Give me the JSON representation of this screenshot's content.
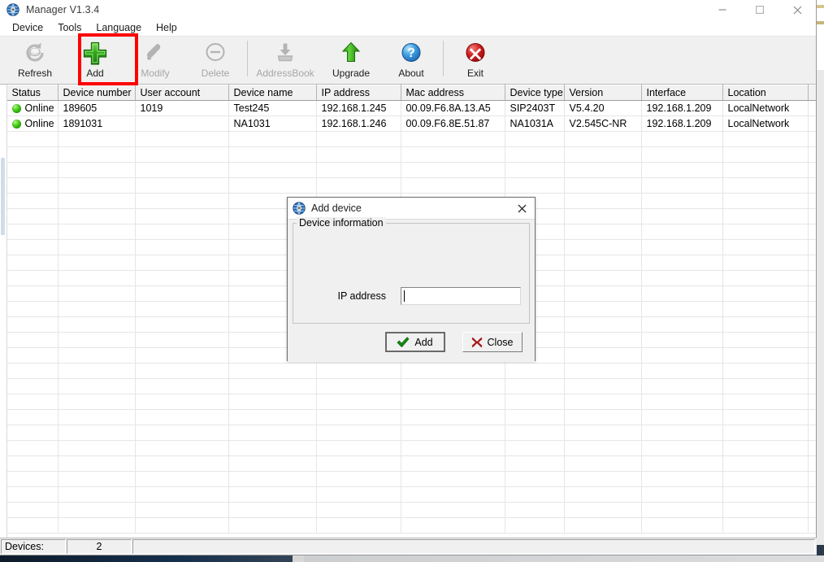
{
  "window": {
    "title": "Manager V1.3.4",
    "icon": "app-globe-icon",
    "controls": {
      "minimize": "minimize-icon",
      "maximize": "maximize-icon",
      "close": "close-icon"
    }
  },
  "menubar": {
    "items": [
      {
        "label": "Device"
      },
      {
        "label": "Tools"
      },
      {
        "label": "Language"
      },
      {
        "label": "Help"
      }
    ]
  },
  "toolbar": {
    "items": [
      {
        "label": "Refresh",
        "icon": "refresh-icon",
        "enabled": true,
        "highlighted": false
      },
      {
        "label": "Add",
        "icon": "add-plus-icon",
        "enabled": true,
        "highlighted": true
      },
      {
        "label": "Modify",
        "icon": "modify-hand-icon",
        "enabled": false,
        "highlighted": false
      },
      {
        "label": "Delete",
        "icon": "delete-minus-icon",
        "enabled": false,
        "highlighted": false
      },
      {
        "label": "AddressBook",
        "icon": "addressbook-icon",
        "enabled": false,
        "highlighted": false
      },
      {
        "label": "Upgrade",
        "icon": "upgrade-arrow-icon",
        "enabled": true,
        "highlighted": false
      },
      {
        "label": "About",
        "icon": "about-question-icon",
        "enabled": true,
        "highlighted": false
      },
      {
        "label": "Exit",
        "icon": "exit-x-icon",
        "enabled": true,
        "highlighted": false
      }
    ],
    "highlight_color": "#ff0000"
  },
  "table": {
    "columns": [
      "Status",
      "Device number",
      "User account",
      "Device name",
      "IP address",
      "Mac address",
      "Device type",
      "Version",
      "Interface",
      "Location",
      ""
    ],
    "rows": [
      {
        "status": "Online",
        "device_number": "189605",
        "user_account": "1019",
        "device_name": "Test245",
        "ip_address": "192.168.1.245",
        "mac_address": "00.09.F6.8A.13.A5",
        "device_type": "SIP2403T",
        "version": "V5.4.20",
        "interface": "192.168.1.209",
        "location": "LocalNetwork",
        "extra": ""
      },
      {
        "status": "Online",
        "device_number": "1891031",
        "user_account": "",
        "device_name": "NA1031",
        "ip_address": "192.168.1.246",
        "mac_address": "00.09.F6.8E.51.87",
        "device_type": "NA1031A",
        "version": "V2.545C-NR",
        "interface": "192.168.1.209",
        "location": "LocalNetwork",
        "extra": ""
      }
    ],
    "empty_row_count": 26,
    "status_led_color": "#35c000"
  },
  "statusbar": {
    "devices_label": "Devices:",
    "devices_count": "2",
    "rest": ""
  },
  "dialog": {
    "title": "Add device",
    "icon": "dialog-globe-icon",
    "close_icon": "close-icon",
    "group_label": "Device information",
    "field": {
      "label": "IP address",
      "value": "",
      "placeholder": ""
    },
    "buttons": [
      {
        "label": "Add",
        "icon": "check-icon",
        "default": true
      },
      {
        "label": "Close",
        "icon": "x-mark-icon",
        "default": false
      }
    ]
  }
}
